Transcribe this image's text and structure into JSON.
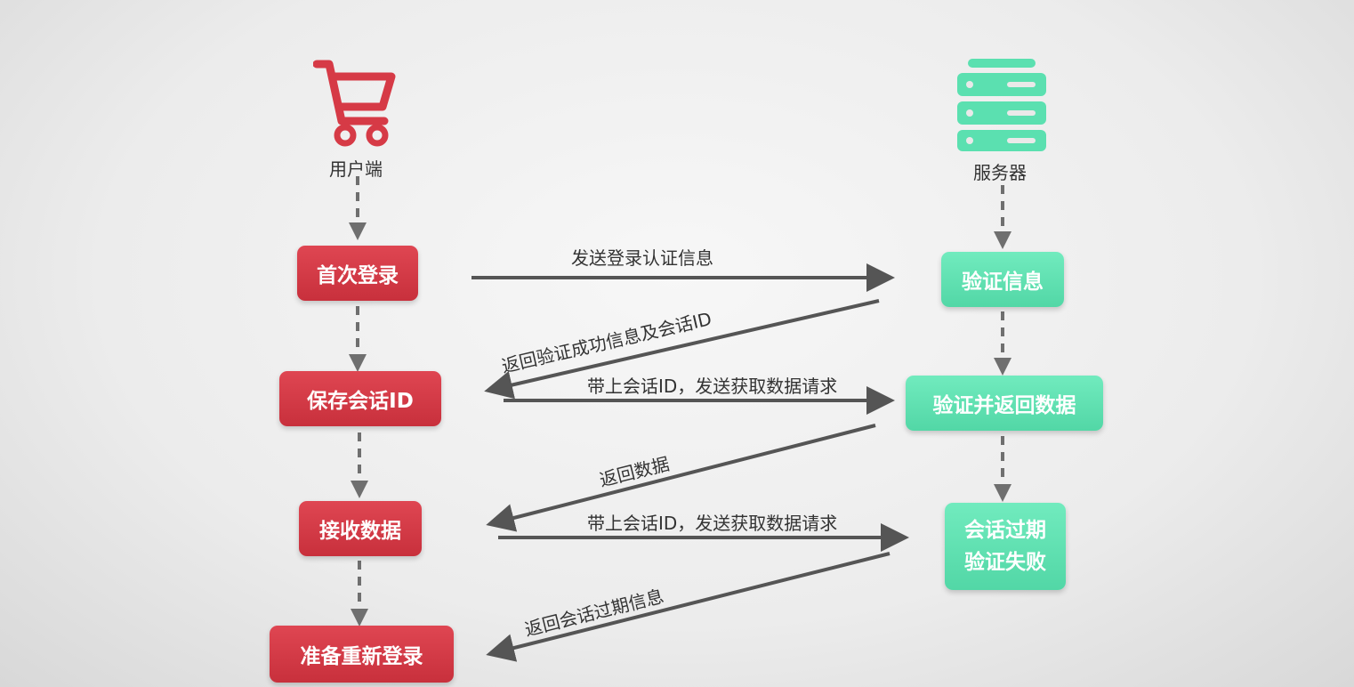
{
  "lanes": {
    "client": {
      "label": "用户端",
      "icon": "shopping-cart-icon",
      "color": "#d63a46"
    },
    "server": {
      "label": "服务器",
      "icon": "server-icon",
      "color": "#5be0b0"
    }
  },
  "client_steps": [
    "首次登录",
    "保存会话ID",
    "接收数据",
    "准备重新登录"
  ],
  "server_steps": [
    {
      "lines": [
        "验证信息"
      ]
    },
    {
      "lines": [
        "验证并返回数据"
      ]
    },
    {
      "lines": [
        "会话过期",
        "验证失败"
      ]
    }
  ],
  "messages": {
    "send_auth": "发送登录认证信息",
    "return_session": "返回验证成功信息及会话ID",
    "request_data_1": "带上会话ID，发送获取数据请求",
    "return_data": "返回数据",
    "request_data_2": "带上会话ID，发送获取数据请求",
    "return_expired": "返回会话过期信息"
  },
  "colors": {
    "arrow": "#555555",
    "connector": "#6f6f6f"
  }
}
